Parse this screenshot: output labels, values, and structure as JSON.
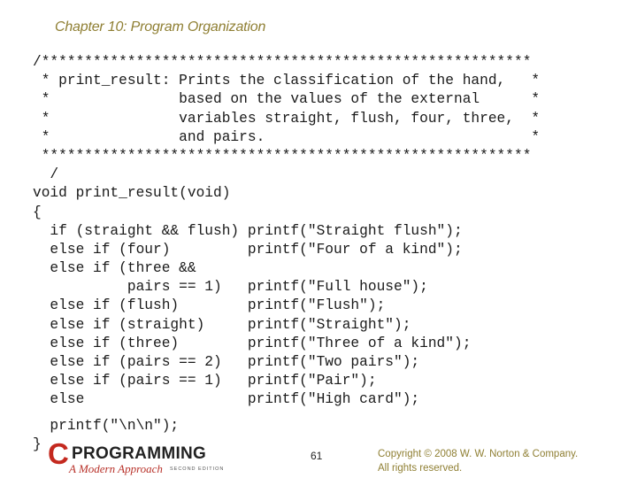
{
  "slide": {
    "title": "Chapter 10: Program Organization",
    "page_number": "61",
    "copyright_line1": "Copyright © 2008 W. W. Norton & Company.",
    "copyright_line2": "All rights reserved."
  },
  "code": {
    "lines": [
      "/*********************************************************",
      " * print_result: Prints the classification of the hand,   *",
      " *               based on the values of the external      *",
      " *               variables straight, flush, four, three,  *",
      " *               and pairs.                               *",
      " *********************************************************",
      "  /",
      "void print_result(void)",
      "{",
      "  if (straight && flush) printf(\"Straight flush\");",
      "  else if (four)         printf(\"Four of a kind\");",
      "  else if (three &&",
      "           pairs == 1)   printf(\"Full house\");",
      "  else if (flush)        printf(\"Flush\");",
      "  else if (straight)     printf(\"Straight\");",
      "  else if (three)        printf(\"Three of a kind\");",
      "  else if (pairs == 2)   printf(\"Two pairs\");",
      "  else if (pairs == 1)   printf(\"Pair\");",
      "  else                   printf(\"High card\");",
      "",
      "  printf(\"\\n\\n\");",
      "}"
    ]
  },
  "logo": {
    "letter": "C",
    "word": "PROGRAMMING",
    "subtitle": "A Modern Approach",
    "edition": "SECOND EDITION"
  }
}
